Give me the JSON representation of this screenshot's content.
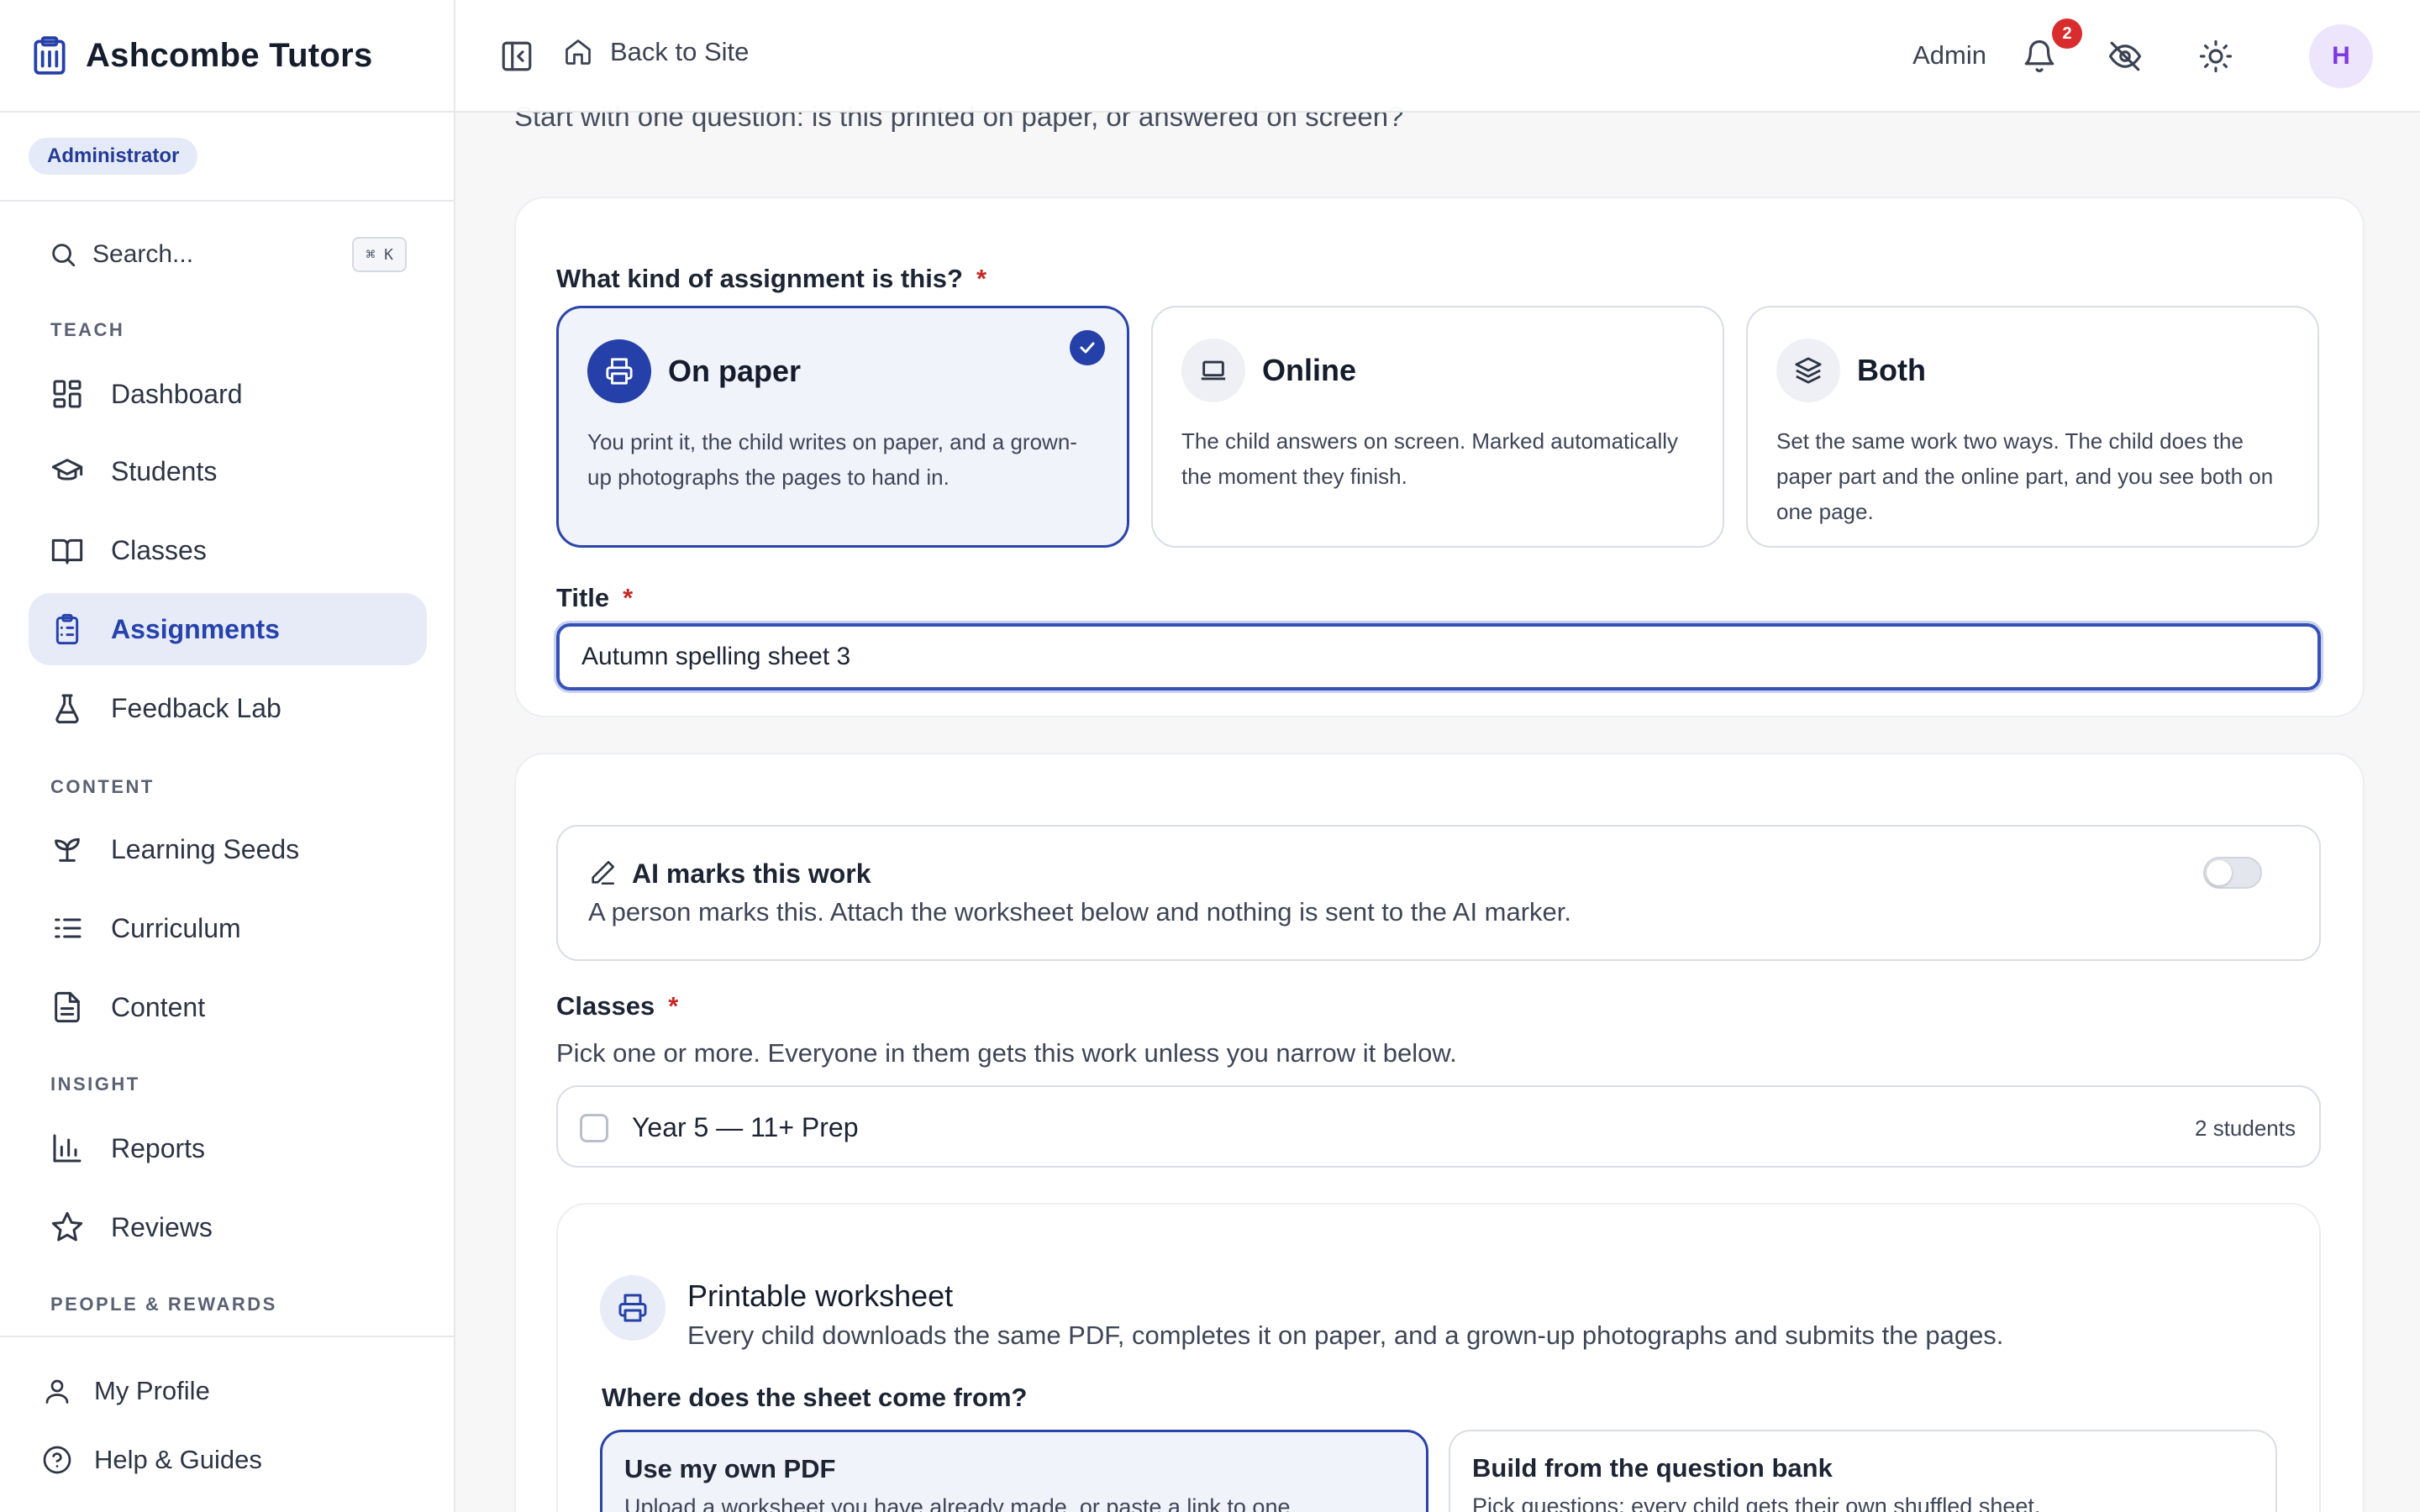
{
  "sidebar": {
    "brand": "Ashcombe Tutors",
    "role": "Administrator",
    "search_placeholder": "Search...",
    "search_shortcut": "⌘ K",
    "sections": {
      "teach": "TEACH",
      "content": "CONTENT",
      "insight": "INSIGHT",
      "people": "PEOPLE & REWARDS"
    },
    "items": {
      "dashboard": "Dashboard",
      "students": "Students",
      "classes": "Classes",
      "assignments": "Assignments",
      "feedback_lab": "Feedback Lab",
      "learning_seeds": "Learning Seeds",
      "curriculum": "Curriculum",
      "content": "Content",
      "reports": "Reports",
      "reviews": "Reviews"
    },
    "bottom": {
      "profile": "My Profile",
      "help": "Help & Guides"
    }
  },
  "topbar": {
    "back_label": "Back to Site",
    "admin_label": "Admin",
    "notification_count": "2",
    "avatar_initial": "H"
  },
  "page": {
    "subtitle": "Start with one question: is this printed on paper, or answered on screen?"
  },
  "assignment_type": {
    "label": "What kind of assignment is this?",
    "required_mark": "*",
    "options": [
      {
        "title": "On paper",
        "description": "You print it, the child writes on paper, and a grown-up photographs the pages to hand in.",
        "selected": true
      },
      {
        "title": "Online",
        "description": "The child answers on screen. Marked automatically the moment they finish.",
        "selected": false
      },
      {
        "title": "Both",
        "description": "Set the same work two ways. The child does the paper part and the online part, and you see both on one page.",
        "selected": false
      }
    ]
  },
  "title_field": {
    "label": "Title",
    "required_mark": "*",
    "value": "Autumn spelling sheet 3"
  },
  "ai_marking": {
    "title": "AI marks this work",
    "description": "A person marks this. Attach the worksheet below and nothing is sent to the AI marker.",
    "enabled": false
  },
  "classes": {
    "label": "Classes",
    "required_mark": "*",
    "help": "Pick one or more. Everyone in them gets this work unless you narrow it below.",
    "items": [
      {
        "name": "Year 5 — 11+ Prep",
        "count": "2 students",
        "checked": false
      }
    ]
  },
  "worksheet": {
    "title": "Printable worksheet",
    "description": "Every child downloads the same PDF, completes it on paper, and a grown-up photographs and submits the pages.",
    "question": "Where does the sheet come from?",
    "options": [
      {
        "title": "Use my own PDF",
        "description": "Upload a worksheet you have already made, or paste a link to one.",
        "selected": true
      },
      {
        "title": "Build from the question bank",
        "description": "Pick questions; every child gets their own shuffled sheet.",
        "selected": false
      }
    ]
  },
  "colors": {
    "accent": "#2540a8",
    "active_nav_bg": "#e7ebf8",
    "badge_red": "#d92d2d",
    "avatar_bg": "#ede5fb"
  }
}
